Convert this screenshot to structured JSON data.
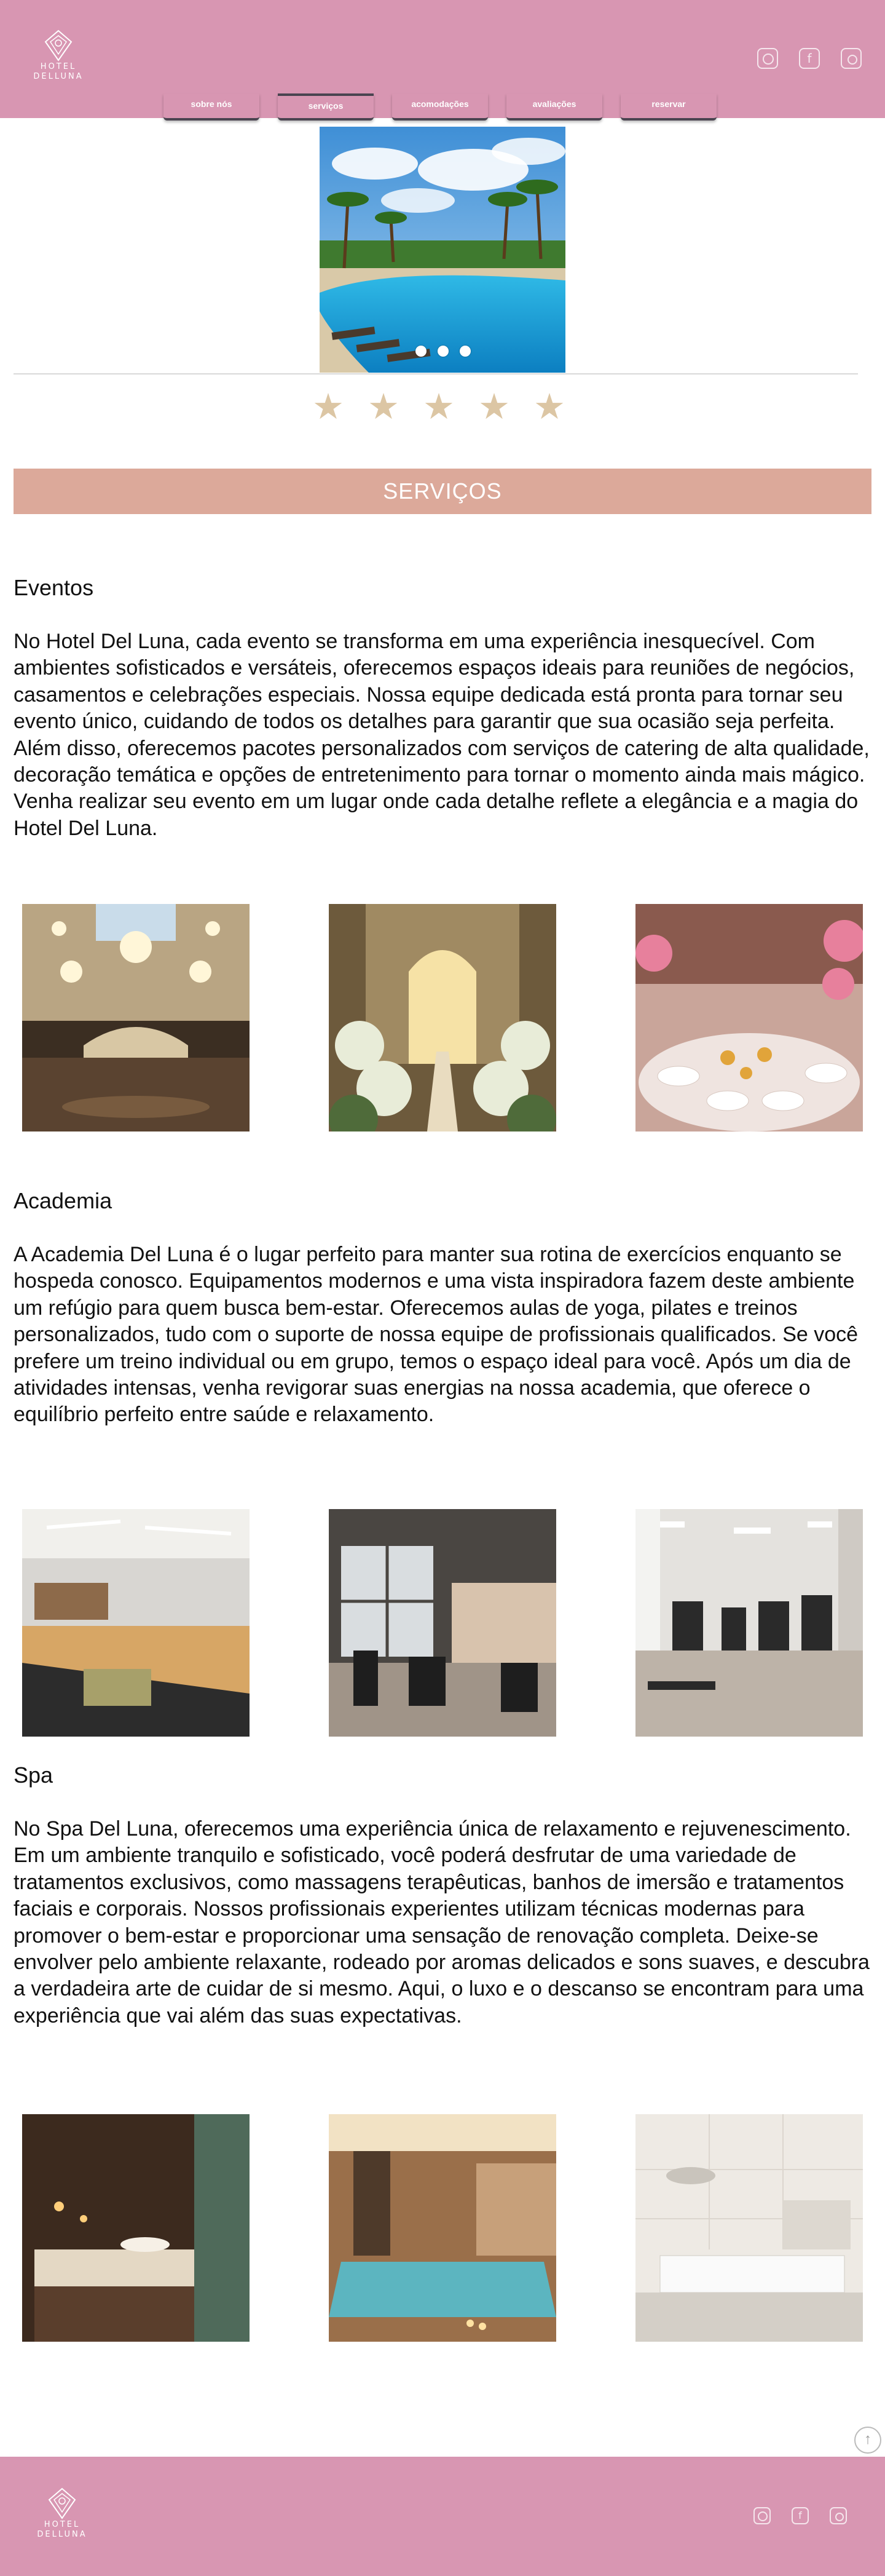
{
  "colors": {
    "brand": "#d896b2",
    "accent": "#dca99a",
    "star": "#dcc6a4"
  },
  "header": {
    "logo_text_line1": "HOTEL",
    "logo_text_line2": "DELLUNA",
    "social": [
      "whatsapp-icon",
      "facebook-icon",
      "instagram-icon"
    ]
  },
  "nav": {
    "tabs": [
      {
        "label": "sobre nós"
      },
      {
        "label": "serviços"
      },
      {
        "label": "acomodações"
      },
      {
        "label": "avaliações"
      },
      {
        "label": "reservar"
      }
    ],
    "active": "serviços"
  },
  "hero": {
    "slides": 3,
    "rating": 5,
    "star_char": "★"
  },
  "section_bar": {
    "title": "SERVIÇOS"
  },
  "sections": [
    {
      "title": "Eventos",
      "text": "No Hotel Del Luna, cada evento se transforma em uma experiência inesquecível. Com ambientes sofisticados e versáteis, oferecemos espaços ideais para reuniões de negócios, casamentos e celebrações especiais. Nossa equipe dedicada está pronta para tornar seu evento único, cuidando de todos os detalhes para garantir que sua ocasião seja perfeita. Além disso, oferecemos pacotes personalizados com serviços de catering de alta qualidade, decoração temática e opções de entretenimento para tornar o momento ainda mais mágico. Venha realizar seu evento em um lugar onde cada detalhe reflete a elegância e a magia do Hotel Del Luna."
    },
    {
      "title": "Academia",
      "text": "A Academia Del Luna é o lugar perfeito para manter sua rotina de exercícios enquanto se hospeda conosco. Equipamentos modernos e uma vista inspiradora fazem deste ambiente um refúgio para quem busca bem-estar. Oferecemos aulas de yoga, pilates e treinos personalizados, tudo com o suporte de nossa equipe de profissionais qualificados. Se você prefere um treino individual ou em grupo, temos o espaço ideal para você. Após um dia de atividades intensas, venha revigorar suas energias na nossa academia, que oferece o equilíbrio perfeito entre saúde e relaxamento."
    },
    {
      "title": "Spa",
      "text": "No Spa Del Luna, oferecemos uma experiência única de relaxamento e rejuvenescimento. Em um ambiente tranquilo e sofisticado, você poderá desfrutar de uma variedade de tratamentos exclusivos, como massagens terapêuticas, banhos de imersão e tratamentos faciais e corporais. Nossos profissionais experientes utilizam técnicas modernas para promover o bem-estar e proporcionar uma sensação de renovação completa. Deixe-se envolver pelo ambiente relaxante, rodeado por aromas delicados e sons suaves, e descubra a verdadeira arte de cuidar de si mesmo. Aqui, o luxo e o descanso se encontram para uma experiência que vai além das suas expectativas."
    }
  ],
  "back_to_top_icon": "↑"
}
